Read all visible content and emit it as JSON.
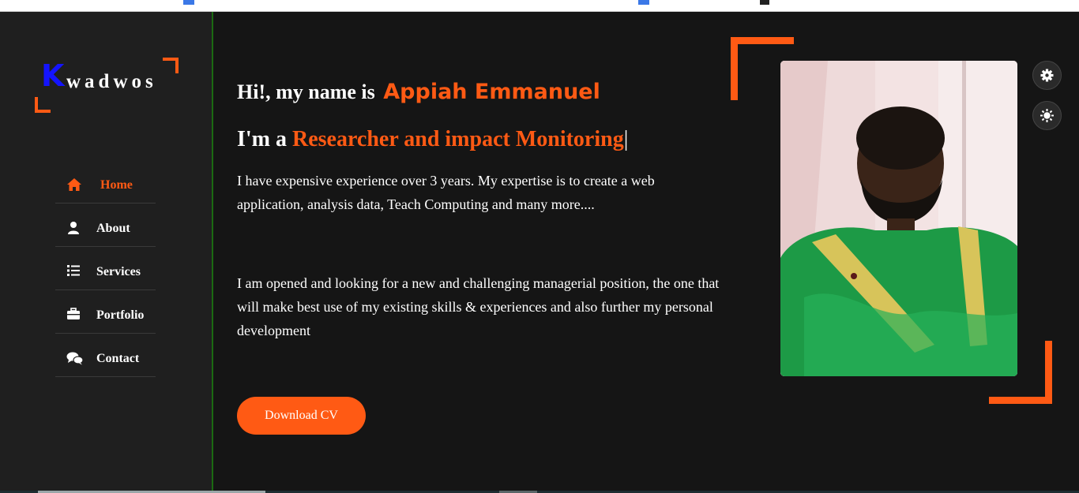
{
  "colors": {
    "accent": "#ff5a14",
    "logo_k": "#1414ff",
    "sidebar_bg": "#1f1f1f",
    "main_bg": "#151515",
    "divider": "#1b6a12"
  },
  "logo": {
    "first_letter": "K",
    "rest": "wadwos"
  },
  "nav": {
    "items": [
      {
        "label": "Home",
        "icon": "home-icon",
        "active": true
      },
      {
        "label": "About",
        "icon": "user-icon",
        "active": false
      },
      {
        "label": "Services",
        "icon": "list-icon",
        "active": false
      },
      {
        "label": "Portfolio",
        "icon": "briefcase-icon",
        "active": false
      },
      {
        "label": "Contact",
        "icon": "chat-icon",
        "active": false
      }
    ]
  },
  "hero": {
    "greeting": "Hi!, my name is",
    "name": "Appiah Emmanuel",
    "role_prefix": "I'm a",
    "role": "Researcher and impact Monitoring",
    "cursor": "|",
    "paragraph1": "I have expensive experience over 3 years. My expertise is to create a web application, analysis data, Teach Computing and many more....",
    "paragraph2": "I am opened and looking for a new and challenging managerial position, the one that will make best use of my existing skills & experiences and also further my personal development",
    "button_label": "Download CV"
  },
  "side_tools": [
    {
      "icon": "settings-gear-icon"
    },
    {
      "icon": "theme-sun-icon"
    }
  ]
}
